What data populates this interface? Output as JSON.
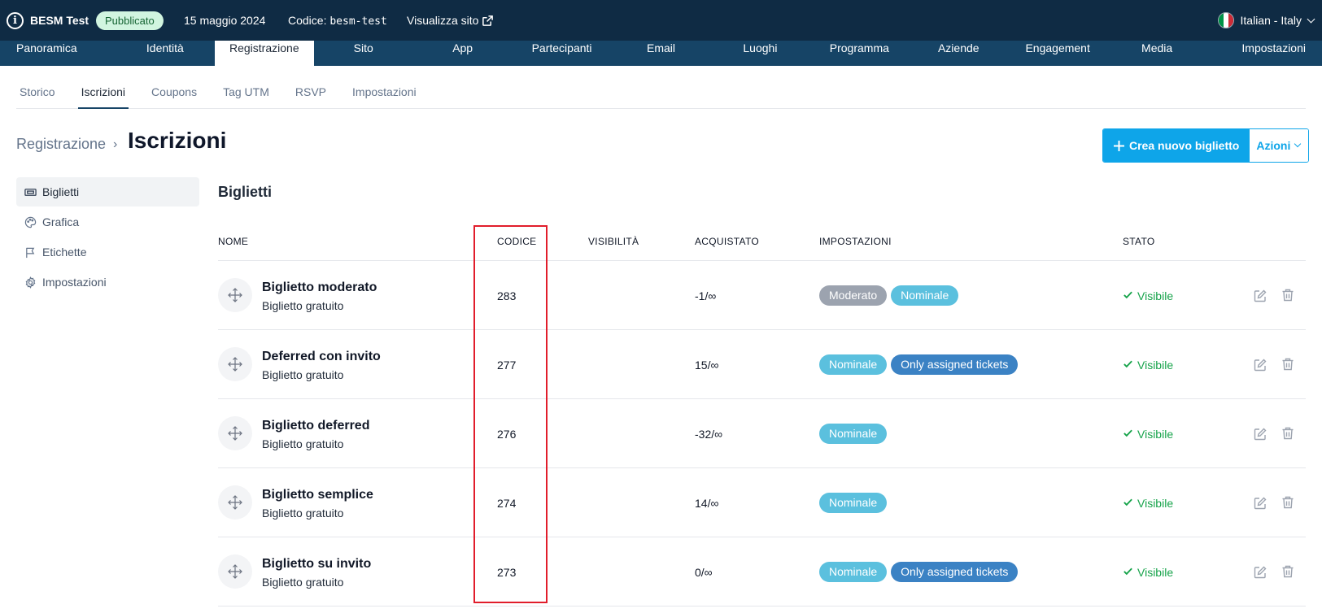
{
  "topbar": {
    "event_name": "BESM Test",
    "status_badge": "Pubblicato",
    "date": "15 maggio 2024",
    "code_label": "Codice:",
    "code_value": "besm-test",
    "view_site": "Visualizza sito",
    "language": "Italian - Italy",
    "flag_colors": [
      "#009246",
      "#ffffff",
      "#ce2b37"
    ]
  },
  "main_nav": {
    "items": [
      {
        "label": "Panoramica"
      },
      {
        "label": "Identità"
      },
      {
        "label": "Registrazione",
        "active": true
      },
      {
        "label": "Sito"
      },
      {
        "label": "App"
      },
      {
        "label": "Partecipanti"
      },
      {
        "label": "Email"
      },
      {
        "label": "Luoghi"
      },
      {
        "label": "Programma"
      },
      {
        "label": "Aziende"
      },
      {
        "label": "Engagement"
      },
      {
        "label": "Media"
      },
      {
        "label": "Impostazioni"
      }
    ]
  },
  "sub_tabs": {
    "items": [
      {
        "label": "Storico"
      },
      {
        "label": "Iscrizioni",
        "active": true
      },
      {
        "label": "Coupons"
      },
      {
        "label": "Tag UTM"
      },
      {
        "label": "RSVP"
      },
      {
        "label": "Impostazioni"
      }
    ]
  },
  "header": {
    "breadcrumb": "Registrazione",
    "separator": "›",
    "title": "Iscrizioni",
    "create_button": "Crea nuovo biglietto",
    "actions_button": "Azioni"
  },
  "side_menu": {
    "items": [
      {
        "label": "Biglietti",
        "icon": "ticket-icon",
        "active": true
      },
      {
        "label": "Grafica",
        "icon": "palette-icon"
      },
      {
        "label": "Etichette",
        "icon": "flag-icon"
      },
      {
        "label": "Impostazioni",
        "icon": "gear-icon"
      }
    ]
  },
  "table": {
    "title": "Biglietti",
    "columns": [
      "NOME",
      "CODICE",
      "VISIBILITÀ",
      "ACQUISTATO",
      "IMPOSTAZIONI",
      "STATO"
    ],
    "rows": [
      {
        "name": "Biglietto moderato",
        "subtitle": "Biglietto gratuito",
        "code": "283",
        "bought": "-1/∞",
        "tags": [
          {
            "label": "Moderato",
            "color": "#9ca3af"
          },
          {
            "label": "Nominale",
            "color": "#5bc0de"
          }
        ],
        "status": "Visibile"
      },
      {
        "name": "Deferred con invito",
        "subtitle": "Biglietto gratuito",
        "code": "277",
        "bought": "15/∞",
        "tags": [
          {
            "label": "Nominale",
            "color": "#5bc0de"
          },
          {
            "label": "Only assigned tickets",
            "color": "#3b82c4"
          }
        ],
        "status": "Visibile"
      },
      {
        "name": "Biglietto deferred",
        "subtitle": "Biglietto gratuito",
        "code": "276",
        "bought": "-32/∞",
        "tags": [
          {
            "label": "Nominale",
            "color": "#5bc0de"
          }
        ],
        "status": "Visibile"
      },
      {
        "name": "Biglietto semplice",
        "subtitle": "Biglietto gratuito",
        "code": "274",
        "bought": "14/∞",
        "tags": [
          {
            "label": "Nominale",
            "color": "#5bc0de"
          }
        ],
        "status": "Visibile"
      },
      {
        "name": "Biglietto su invito",
        "subtitle": "Biglietto gratuito",
        "code": "273",
        "bought": "0/∞",
        "tags": [
          {
            "label": "Nominale",
            "color": "#5bc0de"
          },
          {
            "label": "Only assigned tickets",
            "color": "#3b82c4"
          }
        ],
        "status": "Visibile"
      }
    ]
  },
  "colors": {
    "topbar_bg": "#0f2b44",
    "nav_bg": "#164466",
    "primary": "#0ea5e9",
    "status_green": "#16a34a",
    "highlight_red": "#e11d2b"
  }
}
